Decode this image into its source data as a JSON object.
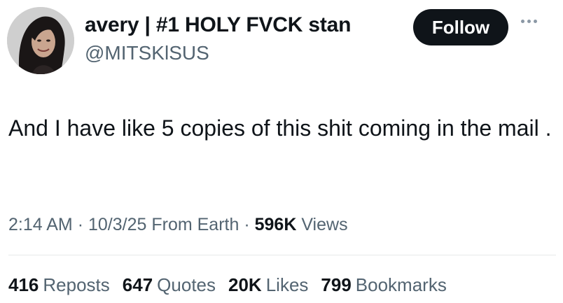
{
  "user": {
    "display_name": "avery | #1 HOLY FVCK stan",
    "handle": "@MITSKlSUS",
    "follow_label": "Follow"
  },
  "tweet": {
    "text": "And I have like 5 copies of this shit coming in the mail .",
    "time": "2:14 AM",
    "date": "10/3/25",
    "location": "From Earth",
    "views_count": "596K",
    "views_label": "Views",
    "separator": "·"
  },
  "stats": [
    {
      "count": "416",
      "label": "Reposts"
    },
    {
      "count": "647",
      "label": "Quotes"
    },
    {
      "count": "20K",
      "label": "Likes"
    },
    {
      "count": "799",
      "label": "Bookmarks"
    }
  ],
  "icons": {
    "more": "more-horizontal-icon"
  },
  "colors": {
    "primary_text": "#0f1419",
    "secondary_text": "#536471",
    "button_bg": "#0f1419",
    "divider": "#e6e9ea"
  }
}
